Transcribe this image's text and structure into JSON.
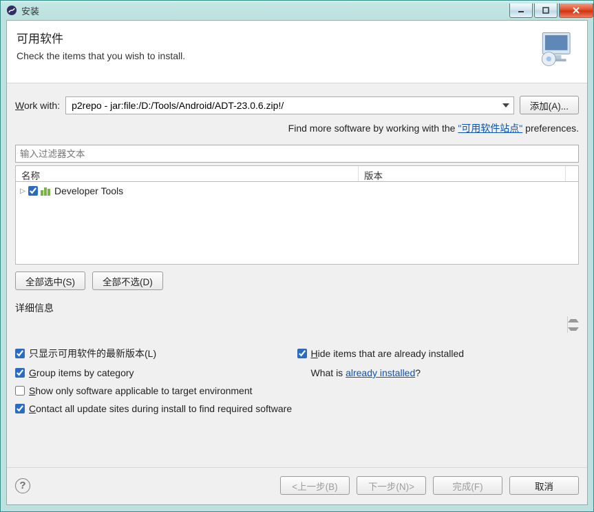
{
  "window": {
    "title": "安装"
  },
  "header": {
    "title": "可用软件",
    "subtitle": "Check the items that you wish to install."
  },
  "work": {
    "label_pre": "W",
    "label_post": "ork with:",
    "value": "p2repo - jar:file:/D:/Tools/Android/ADT-23.0.6.zip!/",
    "add_btn": "添加(A)...",
    "hint_pre": "Find more software by working with the ",
    "hint_link": "\"可用软件站点\"",
    "hint_post": " preferences."
  },
  "filter": {
    "placeholder": "输入过滤器文本"
  },
  "table": {
    "col_name": "名称",
    "col_version": "版本",
    "items": [
      {
        "label": "Developer Tools",
        "checked": true
      }
    ]
  },
  "select": {
    "all": "全部选中(S)",
    "none": "全部不选(D)"
  },
  "details": {
    "label": "详细信息"
  },
  "options": {
    "latest": {
      "checked": true,
      "label": "只显示可用软件的最新版本(L)"
    },
    "hide_installed": {
      "checked": true,
      "label_pre": "H",
      "label_post": "ide items that are already installed"
    },
    "group": {
      "checked": true,
      "label_pre": "G",
      "label_post": "roup items by category"
    },
    "whatis_pre": "What is ",
    "whatis_link": "already installed",
    "whatis_post": "?",
    "applicable": {
      "checked": false,
      "label_pre": "S",
      "label_post": "how only software applicable to target environment"
    },
    "contact": {
      "checked": true,
      "label_pre": "C",
      "label_post": "ontact all update sites during install to find required software"
    }
  },
  "buttons": {
    "back": "<上一步(B)",
    "next": "下一步(N)>",
    "finish": "完成(F)",
    "cancel": "取消"
  }
}
